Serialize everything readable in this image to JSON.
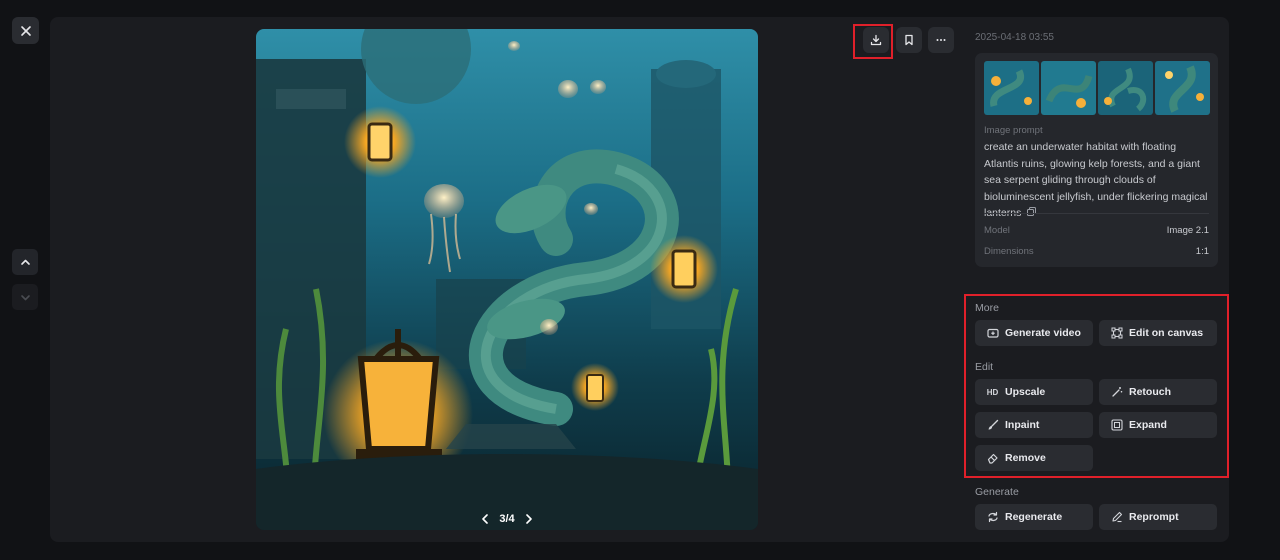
{
  "app": {
    "close_icon": "close-icon",
    "nav_up_icon": "chevron-up-icon",
    "nav_down_icon": "chevron-down-icon"
  },
  "image": {
    "alt": "Underwater habitat with Atlantis ruins and giant sea serpent",
    "pager": "3/4"
  },
  "toolbar": {
    "download_icon": "download-icon",
    "bookmark_icon": "bookmark-icon",
    "more_icon": "more-icon"
  },
  "details": {
    "timestamp": "2025-04-18 03:55",
    "thumbnail_count": 4,
    "prompt_label": "Image prompt",
    "prompt_text": "create an underwater habitat with floating Atlantis ruins, glowing kelp forests, and a giant sea serpent gliding through clouds of bioluminescent jellyfish, under flickering magical lanterns",
    "model_label": "Model",
    "model_value": "Image 2.1",
    "dimensions_label": "Dimensions",
    "dimensions_value": "1:1"
  },
  "sections": {
    "more_label": "More",
    "edit_label": "Edit",
    "generate_label": "Generate"
  },
  "actions": {
    "generate_video": "Generate video",
    "edit_on_canvas": "Edit on canvas",
    "upscale": "Upscale",
    "upscale_badge": "HD",
    "retouch": "Retouch",
    "inpaint": "Inpaint",
    "expand": "Expand",
    "remove": "Remove",
    "regenerate": "Regenerate",
    "reprompt": "Reprompt"
  },
  "colors": {
    "background": "#111215",
    "panel": "#1b1c20",
    "card": "#25272c",
    "button": "#2a2c31",
    "highlight": "#e0202a"
  }
}
